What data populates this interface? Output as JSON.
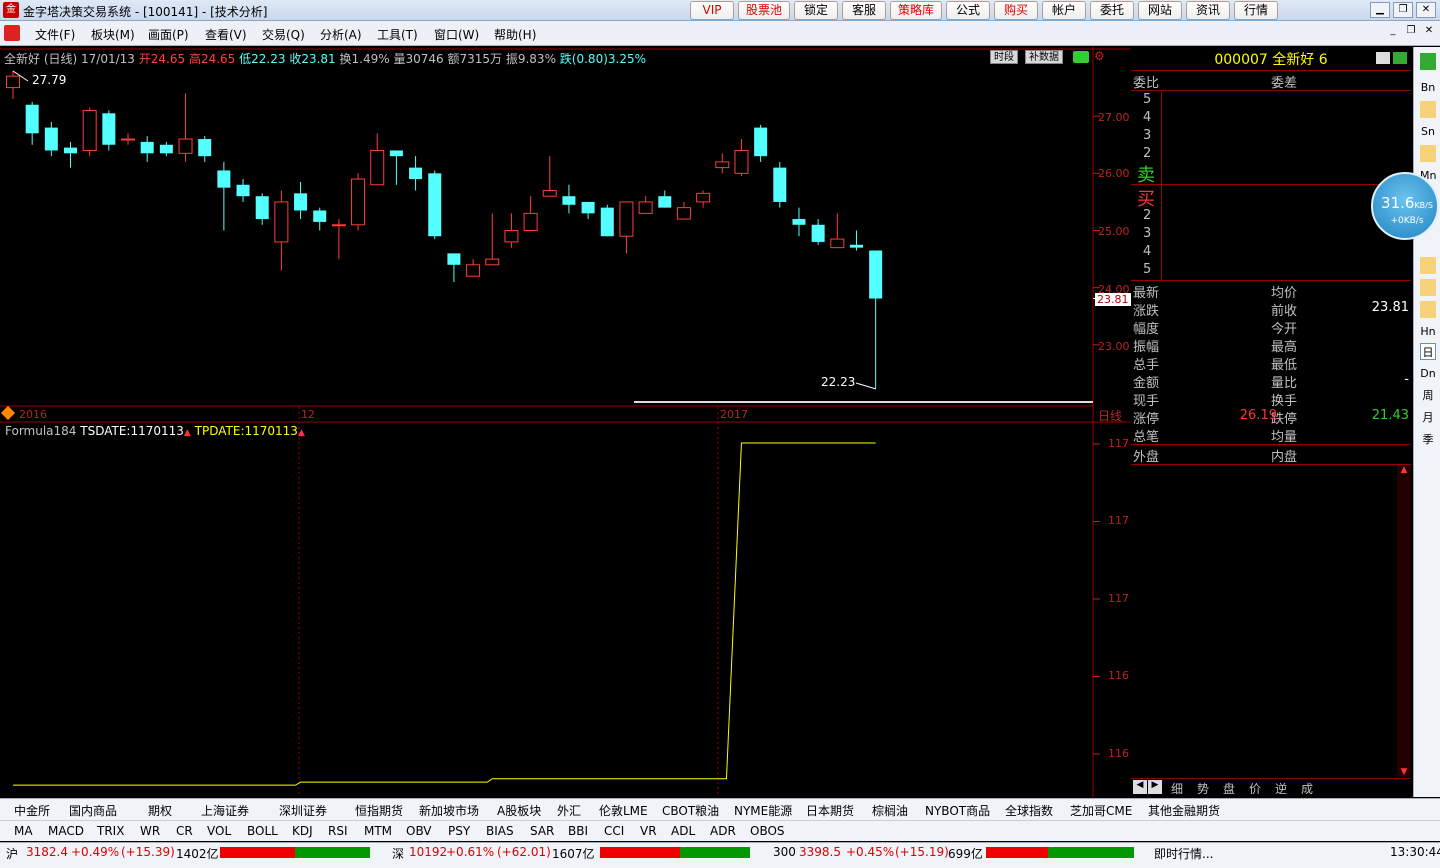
{
  "window": {
    "title": "金字塔决策交易系统 - [100141] - [技术分析]"
  },
  "top_buttons": [
    "VIP",
    "股票池",
    "锁定",
    "客服",
    "策略库",
    "公式",
    "购买",
    "帐户",
    "委托",
    "网站",
    "资讯",
    "行情"
  ],
  "menu": [
    "文件(F)",
    "板块(M)",
    "画面(P)",
    "查看(V)",
    "交易(Q)",
    "分析(A)",
    "工具(T)",
    "窗口(W)",
    "帮助(H)"
  ],
  "chart_header": {
    "name": "全新好 (日线)",
    "date": "17/01/13",
    "open": "开24.65",
    "high": "高24.65",
    "low": "低22.23",
    "close": "收23.81",
    "turnover": "换1.49%",
    "volume": "量30746",
    "amount": "额7315万",
    "amplitude": "振9.83%",
    "change": "跌(0.80)3.25%",
    "btn_period": "时段",
    "btn_fill": "补数据"
  },
  "chart_data": [
    {
      "type": "candlestick",
      "y_ticks": [
        "27.00",
        "26.00",
        "25.00",
        "24.00",
        "23.00"
      ],
      "ylim": [
        22.0,
        28.0
      ],
      "high_label": "27.79",
      "low_label": "22.23",
      "last_price_marker": "23.81",
      "x_labels": [
        "2016",
        "12",
        "2017"
      ],
      "date_marker": "日线",
      "candles": [
        [
          27.5,
          27.7,
          27.79,
          27.3
        ],
        [
          27.2,
          26.7,
          27.25,
          26.5
        ],
        [
          26.8,
          26.4,
          26.9,
          26.3
        ],
        [
          26.45,
          26.35,
          26.55,
          26.1
        ],
        [
          26.4,
          27.1,
          27.15,
          26.3
        ],
        [
          27.05,
          26.5,
          27.1,
          26.4
        ],
        [
          26.6,
          26.6,
          26.7,
          26.5
        ],
        [
          26.55,
          26.35,
          26.65,
          26.2
        ],
        [
          26.5,
          26.35,
          26.55,
          26.3
        ],
        [
          26.35,
          26.6,
          27.4,
          26.2
        ],
        [
          26.6,
          26.3,
          26.65,
          26.2
        ],
        [
          26.05,
          25.75,
          26.2,
          25.0
        ],
        [
          25.8,
          25.6,
          25.9,
          25.5
        ],
        [
          25.6,
          25.2,
          25.65,
          25.1
        ],
        [
          24.8,
          25.5,
          25.7,
          24.3
        ],
        [
          25.65,
          25.35,
          25.85,
          25.2
        ],
        [
          25.35,
          25.15,
          25.4,
          25.0
        ],
        [
          25.1,
          25.1,
          25.2,
          24.5
        ],
        [
          25.1,
          25.9,
          26.0,
          25.0
        ],
        [
          25.8,
          26.4,
          26.7,
          25.8
        ],
        [
          26.4,
          26.3,
          26.4,
          25.8
        ],
        [
          26.1,
          25.9,
          26.3,
          25.7
        ],
        [
          26.0,
          24.9,
          26.05,
          24.85
        ],
        [
          24.6,
          24.4,
          24.6,
          24.1
        ],
        [
          24.2,
          24.4,
          24.5,
          24.2
        ],
        [
          24.4,
          24.5,
          25.3,
          24.4
        ],
        [
          24.8,
          25.0,
          25.3,
          24.7
        ],
        [
          25.0,
          25.3,
          25.6,
          25.1
        ],
        [
          25.6,
          25.7,
          26.3,
          25.6
        ],
        [
          25.6,
          25.45,
          25.8,
          25.3
        ],
        [
          25.5,
          25.3,
          25.5,
          25.2
        ],
        [
          25.4,
          24.9,
          25.45,
          24.9
        ],
        [
          24.9,
          25.5,
          25.5,
          24.6
        ],
        [
          25.3,
          25.5,
          25.6,
          25.3
        ],
        [
          25.6,
          25.4,
          25.7,
          25.4
        ],
        [
          25.2,
          25.4,
          25.5,
          25.2
        ],
        [
          25.5,
          25.65,
          25.7,
          25.4
        ],
        [
          26.1,
          26.2,
          26.35,
          26.0
        ],
        [
          26.0,
          26.4,
          26.6,
          25.95
        ],
        [
          26.8,
          26.3,
          26.85,
          26.2
        ],
        [
          26.1,
          25.5,
          26.2,
          25.4
        ],
        [
          25.2,
          25.1,
          25.4,
          24.9
        ],
        [
          25.1,
          24.8,
          25.2,
          24.75
        ],
        [
          24.7,
          24.85,
          25.3,
          24.7
        ],
        [
          24.75,
          24.7,
          25.0,
          24.65
        ],
        [
          24.65,
          23.81,
          24.65,
          22.23
        ]
      ]
    },
    {
      "type": "line",
      "formula_label": "Formula184",
      "series": [
        {
          "name": "TSDATE",
          "value_label": "TSDATE:1170113",
          "color": "#ffffff"
        },
        {
          "name": "TPDATE",
          "value_label": "TPDATE:1170113",
          "color": "#ffff00"
        }
      ],
      "y_ticks": [
        "117",
        "117",
        "117",
        "116",
        "116"
      ],
      "step_points": [
        [
          0,
          1160112
        ],
        [
          15,
          1160201
        ],
        [
          25,
          1160301
        ],
        [
          38,
          1170113
        ],
        [
          45,
          1170113
        ]
      ]
    }
  ],
  "quote_panel": {
    "code": "000007",
    "name": "全新好",
    "suffix": "6",
    "weibi": "委比",
    "weicha": "委差",
    "sell_levels": [
      "5",
      "4",
      "3",
      "2"
    ],
    "sell_label": "卖",
    "buy_label": "买",
    "buy_levels": [
      "2",
      "3",
      "4",
      "5"
    ],
    "rows_left": [
      "最新",
      "涨跌",
      "幅度",
      "振幅",
      "总手",
      "金额",
      "现手",
      "涨停",
      "总笔"
    ],
    "rows_right": [
      "均价",
      "前收",
      "今开",
      "最高",
      "最低",
      "量比",
      "换手",
      "跌停",
      "均量"
    ],
    "prev_close": "23.81",
    "limit_up": "26.19",
    "limit_down": "21.43",
    "volume_ratio": "-",
    "outer": "外盘",
    "inner": "内盘",
    "bottom_tabs": [
      "细",
      "势",
      "盘",
      "价",
      "逆",
      "成"
    ]
  },
  "side_tools": [
    "Bn",
    "Sn",
    "Mn",
    "Hn",
    "日",
    "Dn",
    "周",
    "月",
    "季"
  ],
  "net_widget": {
    "speed": "31.6",
    "unit": "KB/S",
    "sub": "+0KB/s"
  },
  "market_tabs": [
    "中金所",
    "国内商品",
    "期权",
    "上海证券",
    "深圳证券",
    "恒指期货",
    "新加坡市场",
    "A股板块",
    "外汇",
    "伦敦LME",
    "CBOT粮油",
    "NYME能源",
    "日本期货",
    "棕榈油",
    "NYBOT商品",
    "全球指数",
    "芝加哥CME",
    "其他金融期货"
  ],
  "indicator_tabs": [
    "MA",
    "MACD",
    "TRIX",
    "WR",
    "CR",
    "VOL",
    "BOLL",
    "KDJ",
    "RSI",
    "MTM",
    "OBV",
    "PSY",
    "BIAS",
    "SAR",
    "BBI",
    "CCI",
    "VR",
    "ADL",
    "ADR",
    "OBOS"
  ],
  "status": {
    "sh_label": "沪",
    "sh_value": "3182.4",
    "sh_pct": "+0.49%",
    "sh_chg": "(+15.39)",
    "sh_amt": "1402亿",
    "sz_label": "深",
    "sz_value": "10192",
    "sz_pct": "+0.61%",
    "sz_chg": "(+62.01)",
    "sz_amt": "1607亿",
    "i300_label": "300",
    "i300_value": "3398.5",
    "i300_pct": "+0.45%",
    "i300_chg": "(+15.19)",
    "i300_amt": "699亿",
    "realtime": "即时行情...",
    "time": "13:30:44"
  }
}
